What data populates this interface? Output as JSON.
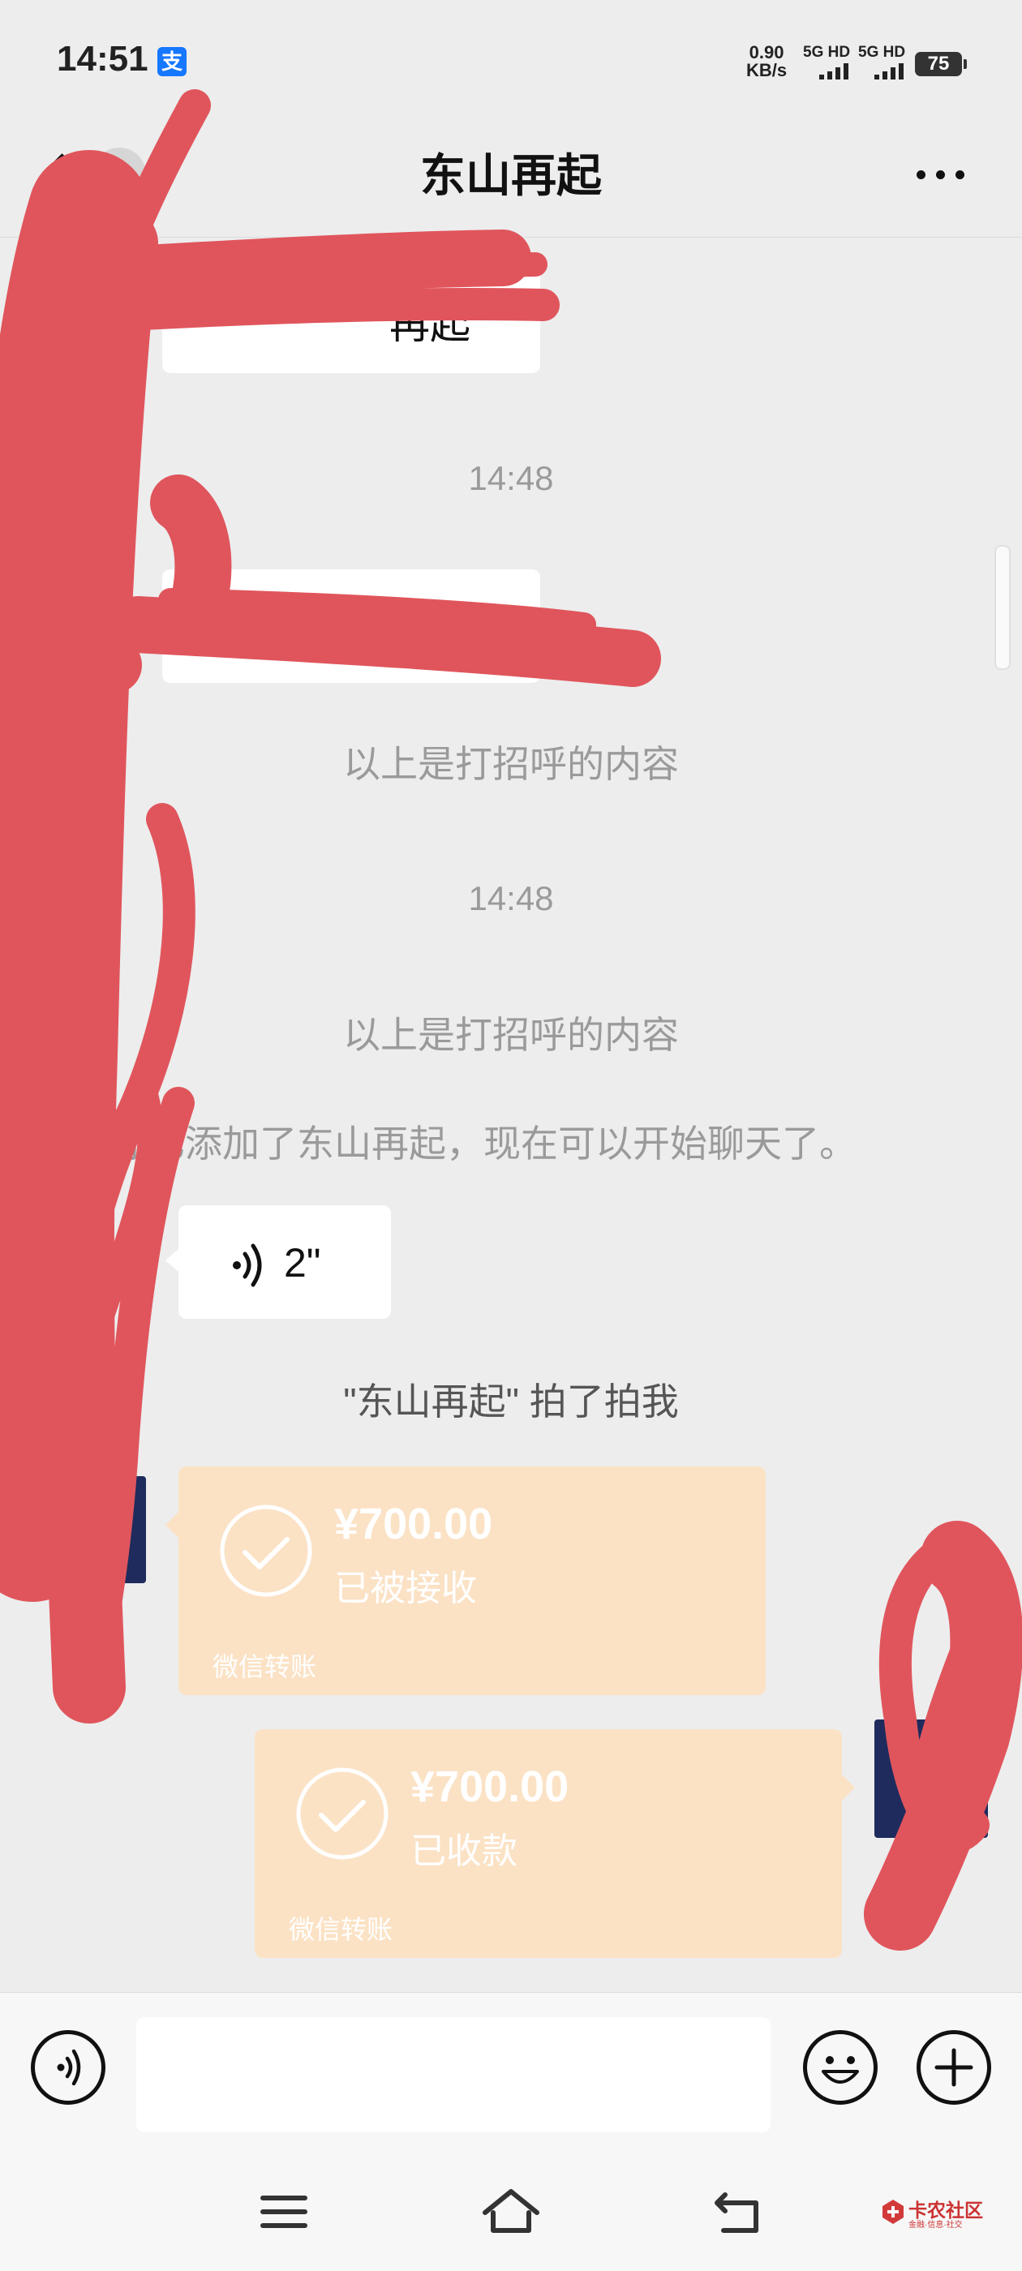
{
  "status_bar": {
    "time": "14:51",
    "alipay_badge": "支",
    "net_speed_value": "0.90",
    "net_speed_unit": "KB/s",
    "sim1": "5G HD",
    "sim2": "5G HD",
    "battery": "75"
  },
  "nav": {
    "unread_count": "1",
    "title": "东山再起"
  },
  "messages": {
    "first_bubble_text": "再起",
    "time_1": "14:48",
    "greeting_note_1": "以上是打招呼的内容",
    "time_2": "14:48",
    "greeting_note_2": "以上是打招呼的内容",
    "added_note": "你已添加了东山再起，现在可以开始聊天了。",
    "voice_duration": "2\"",
    "pat_note": "\"东山再起\" 拍了拍我",
    "transfer_1": {
      "amount": "¥700.00",
      "status": "已被接收",
      "label": "微信转账"
    },
    "transfer_2": {
      "amount": "¥700.00",
      "status": "已收款",
      "label": "微信转账"
    }
  },
  "icons": {
    "voice_toggle": "voice-icon",
    "emoji": "emoji-icon",
    "add": "plus-icon",
    "menu": "menu-icon",
    "home": "home-icon",
    "back": "back-icon"
  },
  "watermark": {
    "title": "卡农社区",
    "subtitle": "金融·信息·社交"
  },
  "colors": {
    "transfer_bg": "#fbe2c5",
    "redaction": "#e0555c",
    "chat_bg": "#ededed"
  }
}
